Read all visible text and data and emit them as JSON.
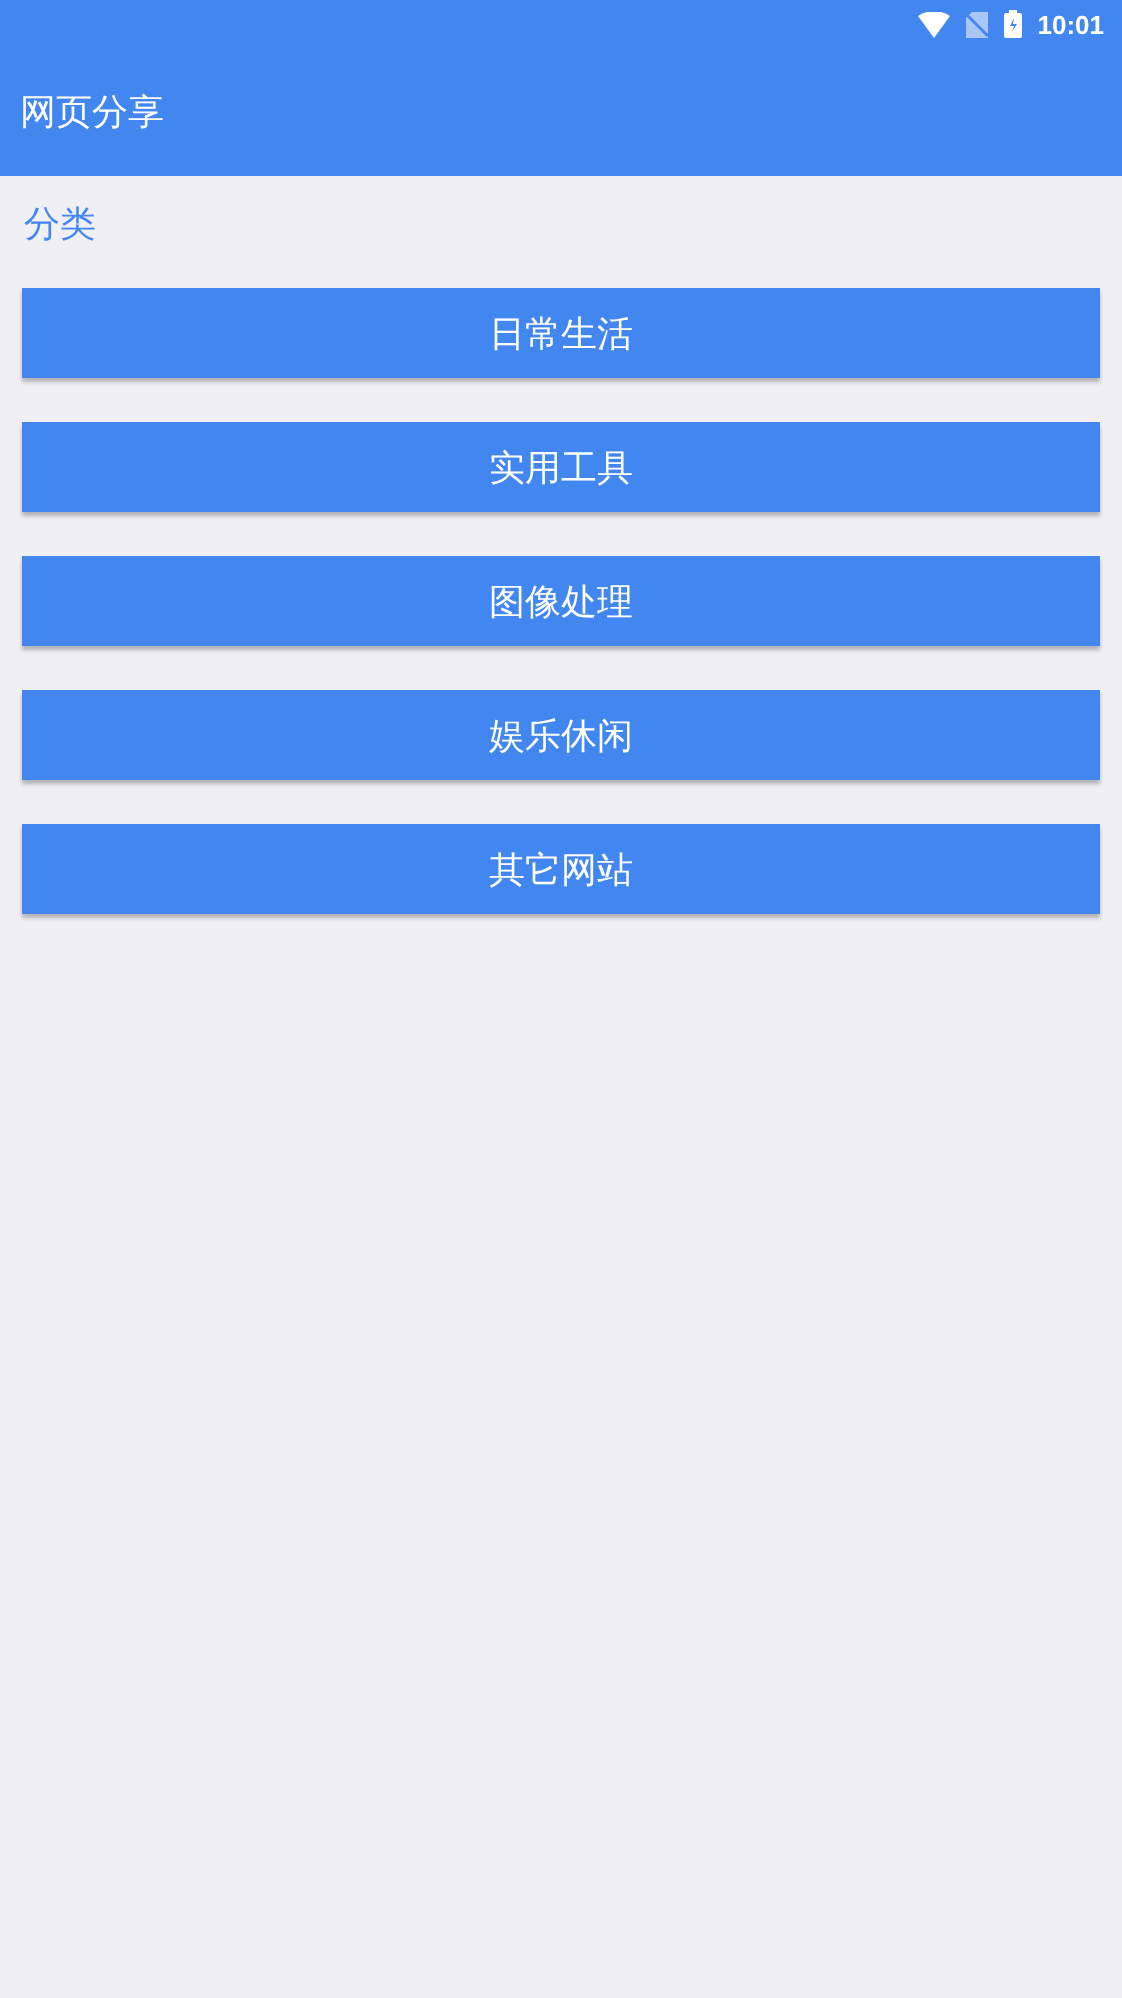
{
  "status_bar": {
    "time": "10:01"
  },
  "app_bar": {
    "title": "网页分享"
  },
  "section": {
    "title": "分类"
  },
  "buttons": [
    {
      "label": "日常生活"
    },
    {
      "label": "实用工具"
    },
    {
      "label": "图像处理"
    },
    {
      "label": "娱乐休闲"
    },
    {
      "label": "其它网站"
    }
  ]
}
